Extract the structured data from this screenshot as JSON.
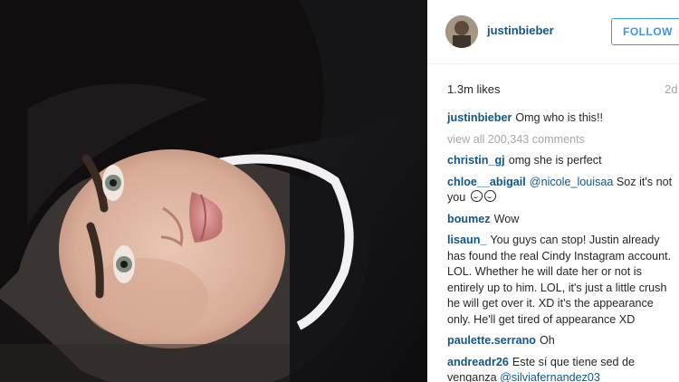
{
  "post": {
    "username": "justinbieber",
    "follow_label": "FOLLOW",
    "likes": "1.3m likes",
    "time_ago": "2d",
    "caption": {
      "user": "justinbieber",
      "text": "Omg who is this!!"
    },
    "view_all": "view all 200,343 comments"
  },
  "comments": [
    {
      "user": "christin_gj",
      "text": "omg she is perfect"
    },
    {
      "user": "chloe__abigail",
      "mention": "@nicole_louisaa",
      "text": "Soz it's not you"
    },
    {
      "user": "boumez",
      "text": "Wow"
    },
    {
      "user": "lisaun_",
      "text": "You guys can stop! Justin already has found the real Cindy Instagram account. LOL. Whether he will date her or not is entirely up to him. LOL, it's just a little crush he will get over it. XD it's the appearance only. He'll get tired of appearance XD"
    },
    {
      "user": "paulette.serrano",
      "text": "Oh"
    },
    {
      "user": "andreadr26",
      "text": "Este sí que tiene sed de venganza",
      "mention": "@silviafernandez03"
    }
  ],
  "colors": {
    "username_blue": "#125688",
    "follow_blue": "#3897f0",
    "muted_gray": "#a5a7aa"
  },
  "icons": {
    "emoji": "two-smiley-emoji-icons"
  }
}
